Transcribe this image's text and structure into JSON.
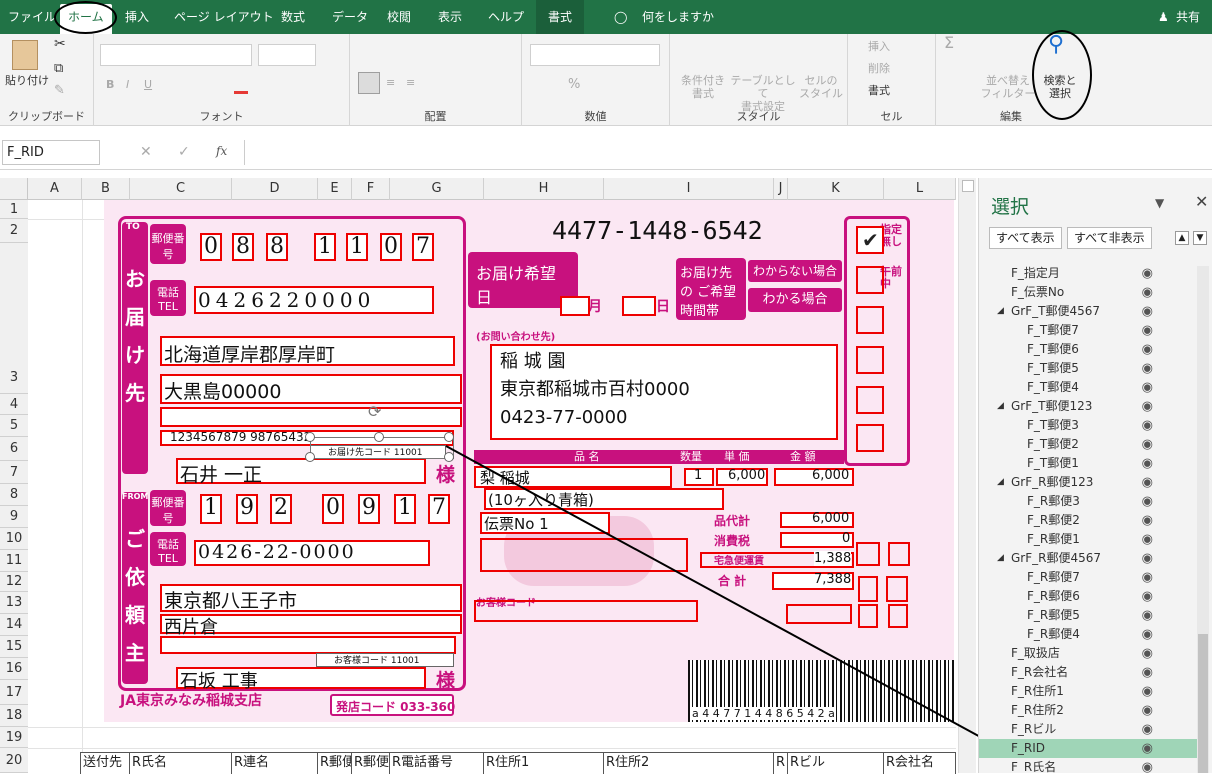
{
  "tabs": {
    "file": "ファイル",
    "home": "ホーム",
    "insert": "挿入",
    "layout": "ページ レイアウト",
    "formulas": "数式",
    "data": "データ",
    "review": "校閲",
    "view": "表示",
    "help": "ヘルプ",
    "format": "書式",
    "tell": "何をしますか",
    "share": "共有"
  },
  "ribbon": {
    "clipboard": {
      "paste": "貼り付け",
      "label": "クリップボード"
    },
    "font": {
      "label": "フォント",
      "bold": "B",
      "italic": "I",
      "underline": "U"
    },
    "align": {
      "label": "配置"
    },
    "number": {
      "label": "数値",
      "percent": "%"
    },
    "style": {
      "label": "スタイル",
      "cond1": "条件付き",
      "cond2": "書式",
      "table1": "テーブルとして",
      "table2": "書式設定",
      "cell1": "セルの",
      "cell2": "スタイル"
    },
    "cells": {
      "label": "セル",
      "insert": "挿入",
      "delete": "削除",
      "format": "書式"
    },
    "edit": {
      "label": "編集",
      "sort1": "並べ替え",
      "sort2": "フィルター",
      "find1": "検索と",
      "find2": "選択"
    }
  },
  "formula_bar": {
    "name_box": "F_RID",
    "fx": "fx"
  },
  "columns": [
    "A",
    "B",
    "C",
    "D",
    "E",
    "F",
    "G",
    "H",
    "I",
    "J",
    "K",
    "L"
  ],
  "rows": [
    "1",
    "2",
    "3",
    "4",
    "5",
    "6",
    "7",
    "8",
    "9",
    "10",
    "11",
    "12",
    "13",
    "14",
    "15",
    "16",
    "17",
    "18",
    "19",
    "20"
  ],
  "slip": {
    "tracking": "4477-1448-6542",
    "to": "TO",
    "from": "FROM",
    "post_label": "郵便番号",
    "tel_label": "電話TEL",
    "dest_vertical": [
      "お",
      "届",
      "け",
      "先"
    ],
    "req_vertical": [
      "ご",
      "依",
      "頼",
      "主"
    ],
    "receiver_zip": [
      "0",
      "8",
      "8",
      "1",
      "1",
      "0",
      "7"
    ],
    "receiver_tel": [
      "0",
      "4",
      "2",
      "6",
      "2",
      "2",
      "0",
      "0",
      "0",
      "0"
    ],
    "receiver_addr1": "北海道厚岸郡厚岸町",
    "receiver_addr2": "大黒島00000",
    "receiver_ids": "1234567879  98765432",
    "receiver_code_label": "お届け先コード 11001",
    "receiver_name": "石井  一正",
    "sama": "様",
    "shipper_zip": [
      "1",
      "9",
      "2",
      "0",
      "9",
      "1",
      "7"
    ],
    "shipper_tel": "0426-22-0000",
    "shipper_addr1": "東京都八王子市",
    "shipper_addr2": "西片倉",
    "shipper_code_label": "お客様コード 11001",
    "shipper_name": "石坂  工事",
    "branch": "JA東京みなみ稲城支店",
    "store_code": "発店コード 033-360",
    "desired_date": "お届け希望日",
    "month": "月",
    "day": "日",
    "desired_time": "お届け先の ご希望時間帯",
    "unknown": "わからない場合",
    "known": "わかる場合",
    "contact_label": "(お問い合わせ先)",
    "contact1": "稲  城  園",
    "contact2": "東京都稲城市百村0000",
    "contact3": "0423-77-0000",
    "item_header": "品    名",
    "qty_header": "数量",
    "price_header": "単 価",
    "amount_header": "金 額",
    "item1": "梨  稲城",
    "item2": "(10ヶ入り青箱)",
    "item3": "伝票No 1",
    "qty": "1",
    "unit_price": "6,000",
    "amount": "6,000",
    "subtotal_label": "品代計",
    "subtotal": "6,000",
    "tax_label": "消費税",
    "tax": "0",
    "delivery_label": "宅急便運賃",
    "delivery": "1,388",
    "total_label": "合 計",
    "total": "7,388",
    "customer_code": "お客様コード",
    "barcode_digits": "a 4 4 7 7 1 4 4 8 6 5 4 2 a",
    "designated": "指定無し",
    "am": "午前中"
  },
  "pane": {
    "title": "選択",
    "show_all": "すべて表示",
    "hide_all": "すべて非表示",
    "items": [
      {
        "label": "F_指定月",
        "indent": 1
      },
      {
        "label": "F_伝票No",
        "indent": 1
      },
      {
        "label": "GrF_T郵便4567",
        "indent": 0,
        "group": true
      },
      {
        "label": "F_T郵便7",
        "indent": 2
      },
      {
        "label": "F_T郵便6",
        "indent": 2
      },
      {
        "label": "F_T郵便5",
        "indent": 2
      },
      {
        "label": "F_T郵便4",
        "indent": 2
      },
      {
        "label": "GrF_T郵便123",
        "indent": 0,
        "group": true
      },
      {
        "label": "F_T郵便3",
        "indent": 2
      },
      {
        "label": "F_T郵便2",
        "indent": 2
      },
      {
        "label": "F_T郵便1",
        "indent": 2
      },
      {
        "label": "GrF_R郵便123",
        "indent": 0,
        "group": true
      },
      {
        "label": "F_R郵便3",
        "indent": 2
      },
      {
        "label": "F_R郵便2",
        "indent": 2
      },
      {
        "label": "F_R郵便1",
        "indent": 2
      },
      {
        "label": "GrF_R郵便4567",
        "indent": 0,
        "group": true
      },
      {
        "label": "F_R郵便7",
        "indent": 2
      },
      {
        "label": "F_R郵便6",
        "indent": 2
      },
      {
        "label": "F_R郵便5",
        "indent": 2
      },
      {
        "label": "F_R郵便4",
        "indent": 2
      },
      {
        "label": "F_取扱店",
        "indent": 1
      },
      {
        "label": "F_R会社名",
        "indent": 1
      },
      {
        "label": "F_R住所1",
        "indent": 1
      },
      {
        "label": "F_R住所2",
        "indent": 1
      },
      {
        "label": "F_Rビル",
        "indent": 1
      },
      {
        "label": "F_RID",
        "indent": 1,
        "selected": true
      },
      {
        "label": "F_R氏名",
        "indent": 1
      }
    ]
  },
  "table_row": [
    "送付先",
    "R氏名",
    "R連名",
    "R郵便",
    "R郵便",
    "R電話番号",
    "R住所1",
    "R住所2",
    "R",
    "Rビル",
    "R会社名"
  ],
  "colors": {
    "excel_green": "#217346",
    "magenta": "#c8117e",
    "red_box": "#e00000",
    "selected": "#9fd5b7"
  }
}
